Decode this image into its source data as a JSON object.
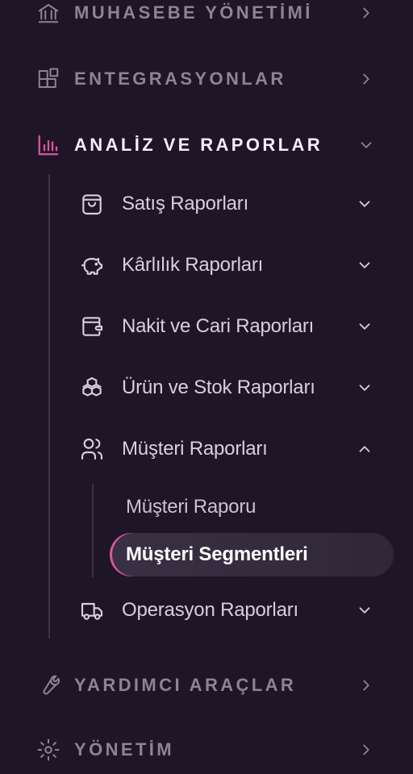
{
  "sidebar": {
    "sections": {
      "muhasebe": {
        "label": "MUHASEBE YÖNETİMİ",
        "icon": "bank-icon"
      },
      "entegrasyon": {
        "label": "ENTEGRASYONLAR",
        "icon": "apps-grid-icon"
      },
      "analiz": {
        "label": "ANALİZ VE RAPORLAR",
        "icon": "bar-chart-icon",
        "expanded": true
      },
      "yardimci": {
        "label": "YARDIMCI ARAÇLAR",
        "icon": "wrench-icon"
      },
      "yonetim": {
        "label": "YÖNETİM",
        "icon": "gear-icon"
      }
    },
    "reports": {
      "satis": {
        "label": "Satış Raporları",
        "icon": "shopping-bag-icon"
      },
      "karlilik": {
        "label": "Kârlılık Raporları",
        "icon": "piggy-bank-icon"
      },
      "nakit": {
        "label": "Nakit ve Cari Raporları",
        "icon": "wallet-icon"
      },
      "urun": {
        "label": "Ürün ve Stok Raporları",
        "icon": "boxes-icon"
      },
      "musteri": {
        "label": "Müşteri Raporları",
        "icon": "users-icon",
        "expanded": true,
        "items": {
          "rapor": {
            "label": "Müşteri Raporu"
          },
          "segment": {
            "label": "Müşteri Segmentleri",
            "active": true
          }
        }
      },
      "operasyon": {
        "label": "Operasyon Raporları",
        "icon": "truck-icon"
      }
    },
    "colors": {
      "accent": "#e0559e",
      "active_text": "#f4eef8",
      "muted_text": "#8c8399",
      "background": "#1e1626"
    }
  }
}
